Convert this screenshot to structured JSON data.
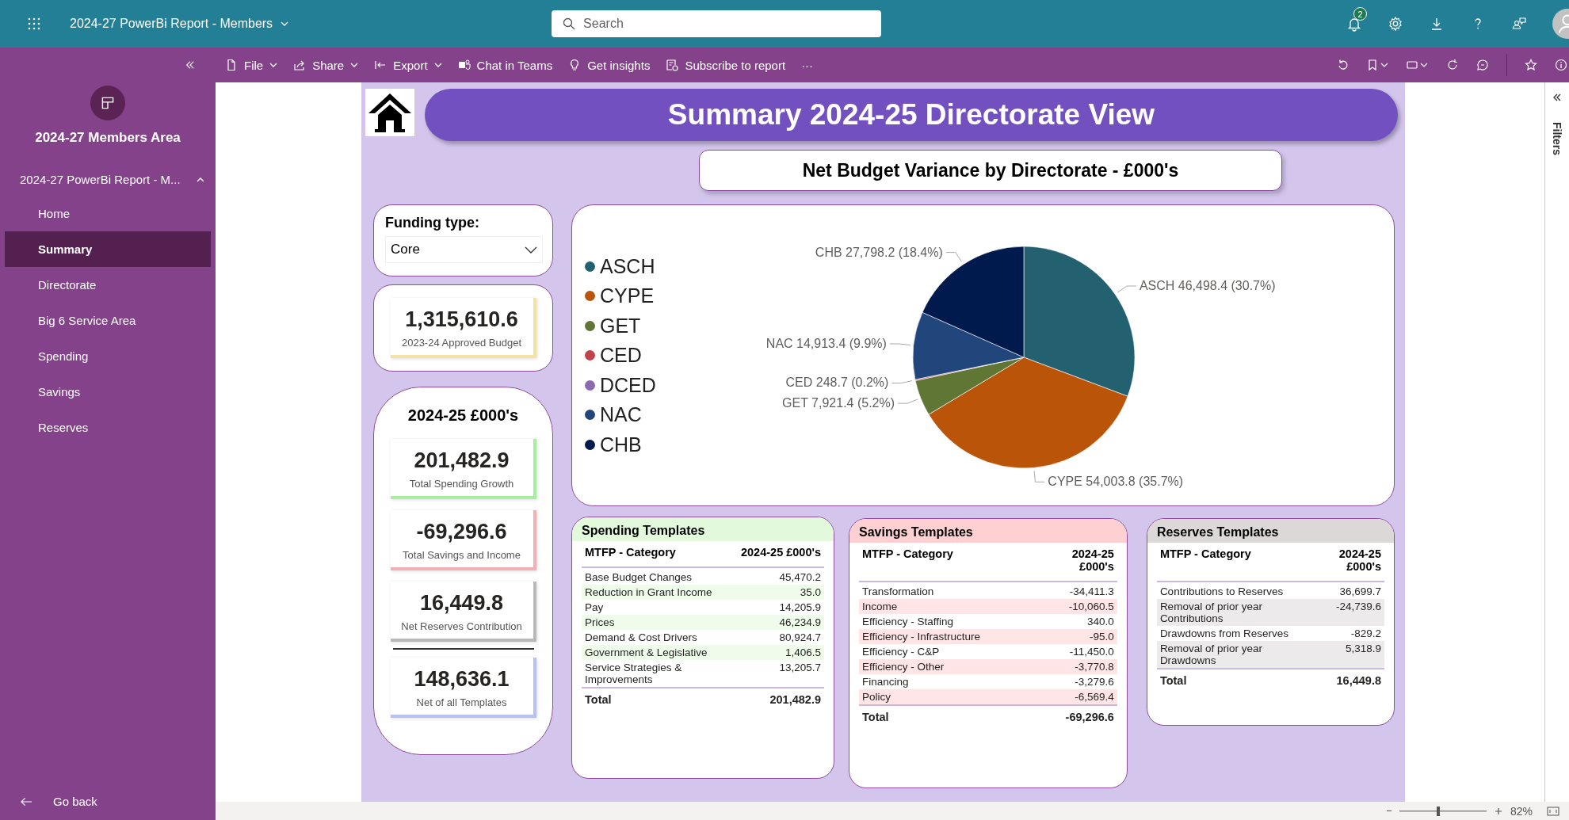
{
  "top_bar": {
    "title": "2024-27 PowerBi Report - Members",
    "search": {
      "placeholder": "Search"
    },
    "notification_count": "2"
  },
  "toolbar": {
    "items": [
      {
        "label": "File",
        "dropdown": true,
        "kind": "file"
      },
      {
        "label": "Share",
        "dropdown": true,
        "kind": "share"
      },
      {
        "label": "Export",
        "dropdown": true,
        "kind": "export"
      },
      {
        "label": "Chat in Teams",
        "dropdown": false,
        "kind": "teams"
      },
      {
        "label": "Get insights",
        "dropdown": false,
        "kind": "insights"
      },
      {
        "label": "Subscribe to report",
        "dropdown": false,
        "kind": "subscribe"
      },
      {
        "label": "···",
        "dropdown": false,
        "kind": "more"
      }
    ]
  },
  "sidebar": {
    "workspace": "2024-27 Members Area",
    "report": {
      "label": "2024-27 PowerBi Report - M...",
      "expanded": true
    },
    "items": [
      {
        "label": "Home",
        "selected": false
      },
      {
        "label": "Summary",
        "selected": true
      },
      {
        "label": "Directorate",
        "selected": false
      },
      {
        "label": "Big 6 Service Area",
        "selected": false
      },
      {
        "label": "Spending",
        "selected": false
      },
      {
        "label": "Savings",
        "selected": false
      },
      {
        "label": "Reserves",
        "selected": false
      }
    ],
    "back": "Go back"
  },
  "report": {
    "title": "Summary 2024-25 Directorate View",
    "chart_title": "Net Budget Variance by Directorate - £000's",
    "funding": {
      "label": "Funding type:",
      "value": "Core"
    },
    "budget": {
      "value": "1,315,610.6",
      "label": "2023-24 Approved Budget",
      "color": "#f2e3a2"
    },
    "year_panel": {
      "title": "2024-25 £000's",
      "kpis": [
        {
          "kind": "item",
          "value": "201,482.9",
          "label": "Total Spending Growth",
          "color": "#a8eea0"
        },
        {
          "kind": "item",
          "value": "-69,296.6",
          "label": "Total Savings and Income",
          "color": "#f3b0b4"
        },
        {
          "kind": "item",
          "value": "16,449.8",
          "label": "Net Reserves Contribution",
          "color": "#b9b9b9"
        },
        {
          "kind": "net",
          "value": "148,636.1",
          "label": "Net of all Templates",
          "color": "#b8c2ee"
        }
      ]
    },
    "pie": {
      "chart_data": {
        "type": "pie",
        "legend": "left",
        "categories": [
          "ASCH",
          "CYPE",
          "GET",
          "CED",
          "DCED",
          "NAC",
          "CHB"
        ],
        "colors": [
          "#236170",
          "#b95408",
          "#607634",
          "#c0434b",
          "#8b6bb0",
          "#20467c",
          "#011a4d"
        ],
        "values": [
          46498.4,
          54003.8,
          7921.4,
          248.7,
          0,
          14913.4,
          27798.2
        ],
        "value_labels": [
          "ASCH 46,498.4 (30.7%)",
          "CYPE 54,003.8 (35.7%)",
          "GET 7,921.4 (5.2%)",
          "CED 248.7 (0.2%)",
          null,
          "NAC 14,913.4 (9.9%)",
          "CHB 27,798.2 (18.4%)"
        ]
      }
    },
    "tables": [
      {
        "title": "Spending Templates",
        "color": "#e2fadb",
        "column_1": "MTFP - Category",
        "column_2": "2024-25 £000's",
        "rows": [
          [
            "Base Budget Changes",
            "45,470.2"
          ],
          [
            "Reduction in Grant Income",
            "35.0"
          ],
          [
            "Pay",
            "14,205.9"
          ],
          [
            "Prices",
            "46,234.9"
          ],
          [
            "Demand & Cost Drivers",
            "80,924.7"
          ],
          [
            "Government & Legislative",
            "1,406.5"
          ],
          [
            "Service Strategies & Improvements",
            "13,205.7"
          ]
        ],
        "total": [
          "Total",
          "201,482.9"
        ]
      },
      {
        "title": "Savings Templates",
        "color": "#ffd0d2",
        "column_1": "MTFP - Category",
        "column_2": "2024-25 £000's",
        "rows": [
          [
            "Transformation",
            "-34,411.3"
          ],
          [
            "Income",
            "-10,060.5"
          ],
          [
            "Efficiency - Staffing",
            "340.0"
          ],
          [
            "Efficiency - Infrastructure",
            "-95.0"
          ],
          [
            "Efficiency - C&P",
            "-11,450.0"
          ],
          [
            "Efficiency - Other",
            "-3,770.8"
          ],
          [
            "Financing",
            "-3,279.6"
          ],
          [
            "Policy",
            "-6,569.4"
          ]
        ],
        "total": [
          "Total",
          "-69,296.6"
        ]
      },
      {
        "title": "Reserves Templates",
        "color": "#dcd8d8",
        "column_1": "MTFP - Category",
        "column_2": "2024-25 £000's",
        "rows": [
          [
            "Contributions to Reserves",
            "36,699.7"
          ],
          [
            "Removal of prior year Contributions",
            "-24,739.6"
          ],
          [
            "Drawdowns from Reserves",
            "-829.2"
          ],
          [
            "Removal of prior year Drawdowns",
            "5,318.9"
          ]
        ],
        "total": [
          "Total",
          "16,449.8"
        ]
      }
    ]
  },
  "filters": {
    "label": "Filters"
  },
  "status_bar": {
    "zoom": {
      "level": 0.45,
      "reading": "82%"
    }
  }
}
